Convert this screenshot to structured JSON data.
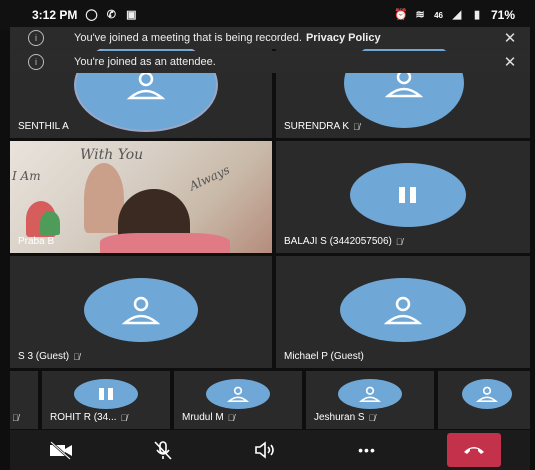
{
  "status_bar": {
    "time": "3:12 PM",
    "battery": "71%",
    "signal": "46"
  },
  "banners": [
    {
      "text": "You've joined a meeting that is being recorded.",
      "link": "Privacy Policy",
      "close": "✕"
    },
    {
      "text": "You're joined as an attendee.",
      "link": "",
      "close": "✕"
    }
  ],
  "participants": [
    {
      "name": "SENTHIL A",
      "muted": false
    },
    {
      "name": "SURENDRA K",
      "muted": true
    },
    {
      "name": "Praba B",
      "muted": false,
      "video": true
    },
    {
      "name": "BALAJI S (3442057506)",
      "muted": true
    },
    {
      "name": "S 3 (Guest)",
      "muted": true
    },
    {
      "name": "Michael P (Guest)",
      "muted": false
    }
  ],
  "strip": [
    {
      "name": "",
      "muted": true
    },
    {
      "name": "ROHIT R (34...",
      "muted": true
    },
    {
      "name": "Mrudul M",
      "muted": true
    },
    {
      "name": "Jeshuran S",
      "muted": true
    },
    {
      "name": "",
      "muted": false
    }
  ],
  "video_wall_text": {
    "line1": "With You",
    "line2": "I Am",
    "line3": "Always"
  },
  "toolbar": {
    "icons": [
      "video-off-icon",
      "mic-off-icon",
      "speaker-icon",
      "more-icon",
      "hang-up-icon"
    ],
    "more_label": "•••"
  },
  "colors": {
    "avatar": "#6fa7d6",
    "end_call": "#c4314b",
    "tile": "#2a2a2a"
  }
}
